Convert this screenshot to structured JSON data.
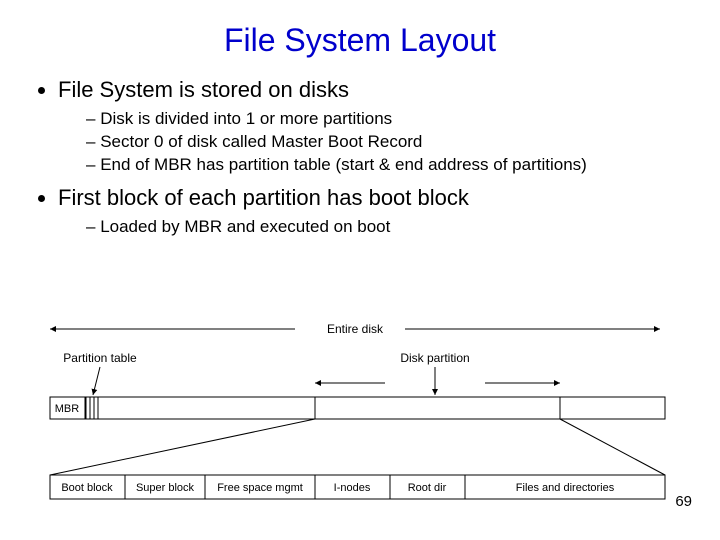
{
  "title": "File System Layout",
  "bullets": {
    "b1": "File System is stored on disks",
    "b1a": "Disk is divided into 1 or more partitions",
    "b1b": "Sector 0 of disk called Master Boot Record",
    "b1c": "End of MBR has partition table (start & end address of partitions)",
    "b2": "First block of each partition has boot block",
    "b2a": "Loaded by MBR and executed on boot"
  },
  "diagram": {
    "top_label": "Entire disk",
    "label_partition_table": "Partition table",
    "label_disk_partition": "Disk partition",
    "mbr": "MBR",
    "detail": {
      "boot_block": "Boot block",
      "super_block": "Super block",
      "free_space": "Free space mgmt",
      "inodes": "I-nodes",
      "root_dir": "Root dir",
      "files_dirs": "Files and directories"
    }
  },
  "page_number": "69"
}
